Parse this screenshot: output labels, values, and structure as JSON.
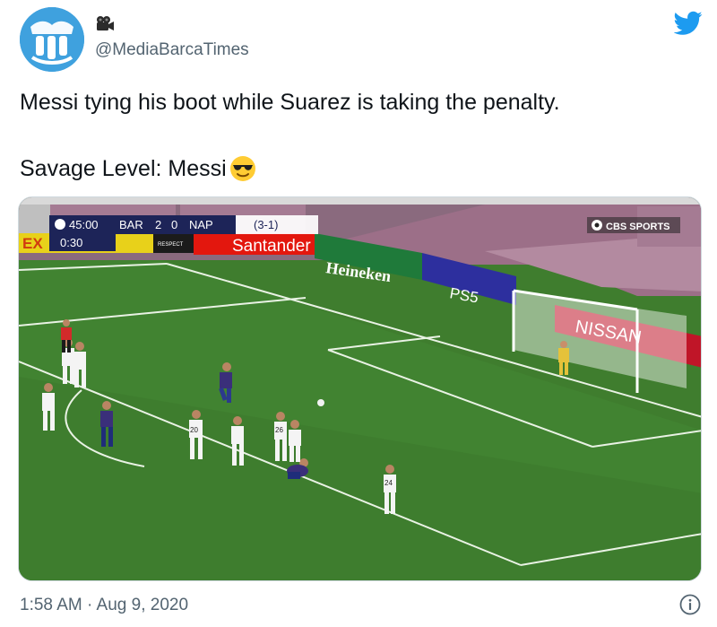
{
  "author": {
    "handle": "@MediaBarcaTimes"
  },
  "tweet": {
    "line1": "Messi tying his boot while Suarez is taking the penalty.",
    "line2": "Savage Level: Messi"
  },
  "scoreboard": {
    "clock": "45:00",
    "home": "BAR",
    "home_score": "2",
    "away_score": "0",
    "away": "NAP",
    "aggregate": "(3-1)",
    "sub_timer": "0:30"
  },
  "broadcaster": "CBS SPORTS",
  "ads": {
    "respect": "RESPECT",
    "santander": "Santander",
    "heineken": "Heineken",
    "ps5": "PS5",
    "nissan": "NISSAN",
    "partial": "EX"
  },
  "jerseys": {
    "a": "20",
    "b": "26",
    "c": "24"
  },
  "footer": {
    "timestamp": "1:58 AM · Aug 9, 2020"
  },
  "colors": {
    "twitter_blue": "#1d9bf0",
    "muted": "#536471",
    "pitch": "#3f7d2e",
    "seats": "#9c6f88"
  }
}
